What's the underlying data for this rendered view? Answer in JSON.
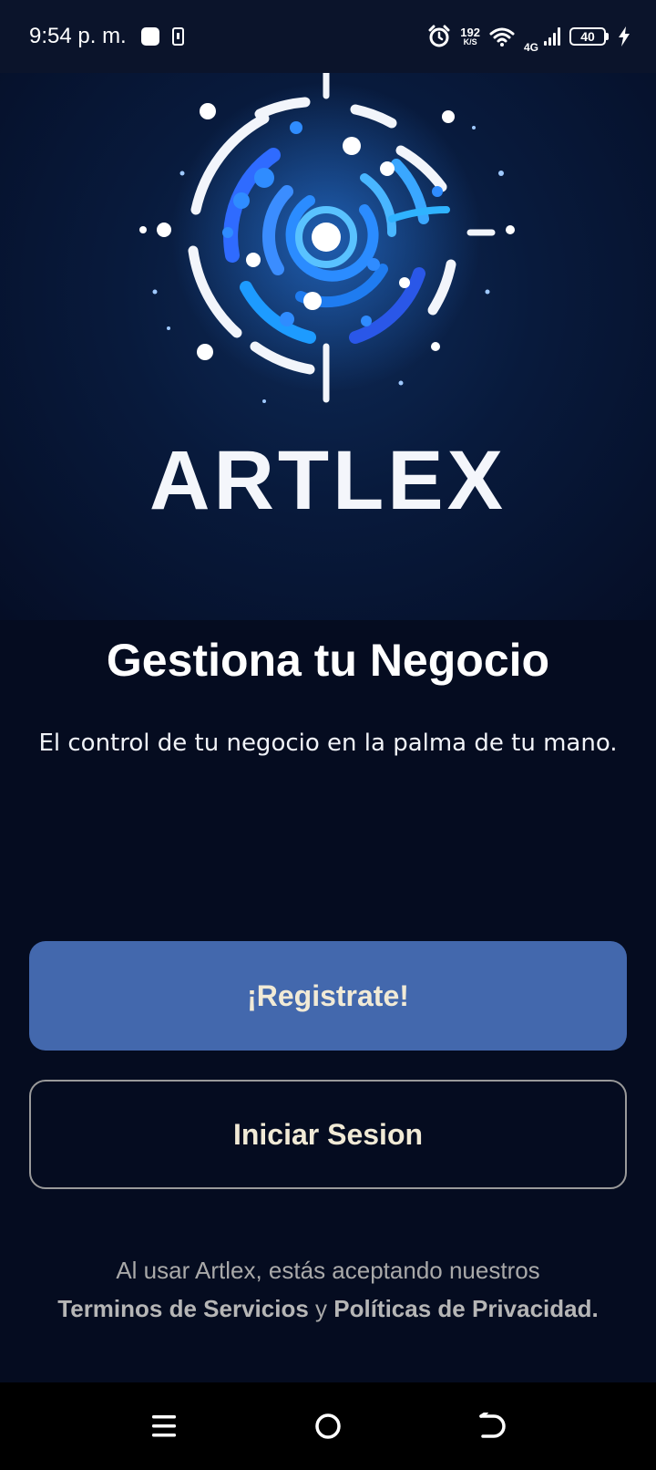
{
  "status_bar": {
    "time": "9:54 p. m.",
    "net_speed": "192",
    "net_speed_unit": "K/S",
    "network_type": "4G",
    "battery": "40"
  },
  "hero": {
    "brand": "ARTLEX"
  },
  "content": {
    "headline": "Gestiona tu Negocio",
    "subheadline": "El control de tu negocio en la palma de tu mano."
  },
  "buttons": {
    "register": "¡Registrate!",
    "login": "Iniciar Sesion"
  },
  "legal": {
    "line1": "Al usar Artlex, estás aceptando nuestros",
    "terms": "Terminos de Servicios",
    "conjunction": " y ",
    "privacy": "Políticas de Privacidad",
    "period": "."
  },
  "icons": {
    "alarm": "alarm-icon",
    "wifi": "wifi-icon",
    "signal": "signal-icon",
    "battery": "battery-icon",
    "charging": "charging-bolt-icon",
    "nav_menu": "menu-icon",
    "nav_home": "home-circle-icon",
    "nav_back": "back-icon"
  },
  "colors": {
    "background": "#050c20",
    "register_button": "#4368ad",
    "button_text": "#f1ead6",
    "outline": "#9a9a9a"
  }
}
